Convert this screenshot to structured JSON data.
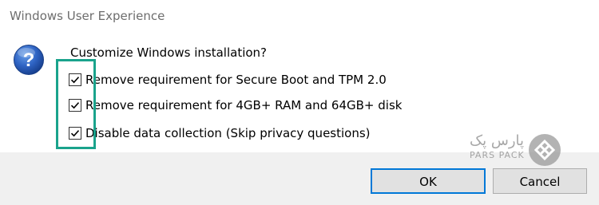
{
  "window": {
    "title": "Windows User Experience"
  },
  "dialog": {
    "question": "Customize Windows installation?",
    "icon": "question-icon"
  },
  "options": [
    {
      "label": "Remove requirement for Secure Boot and TPM 2.0",
      "checked": true
    },
    {
      "label": "Remove requirement for 4GB+ RAM and 64GB+ disk",
      "checked": true
    },
    {
      "label": "Disable data collection (Skip privacy questions)",
      "checked": true
    }
  ],
  "buttons": {
    "ok": "OK",
    "cancel": "Cancel"
  },
  "watermark": {
    "arabic": "پارس پک",
    "latin": "PARS PACK"
  },
  "colors": {
    "highlight": "#1aa38c",
    "default_button_border": "#0078d7",
    "footer_background": "#f0f0f0"
  }
}
